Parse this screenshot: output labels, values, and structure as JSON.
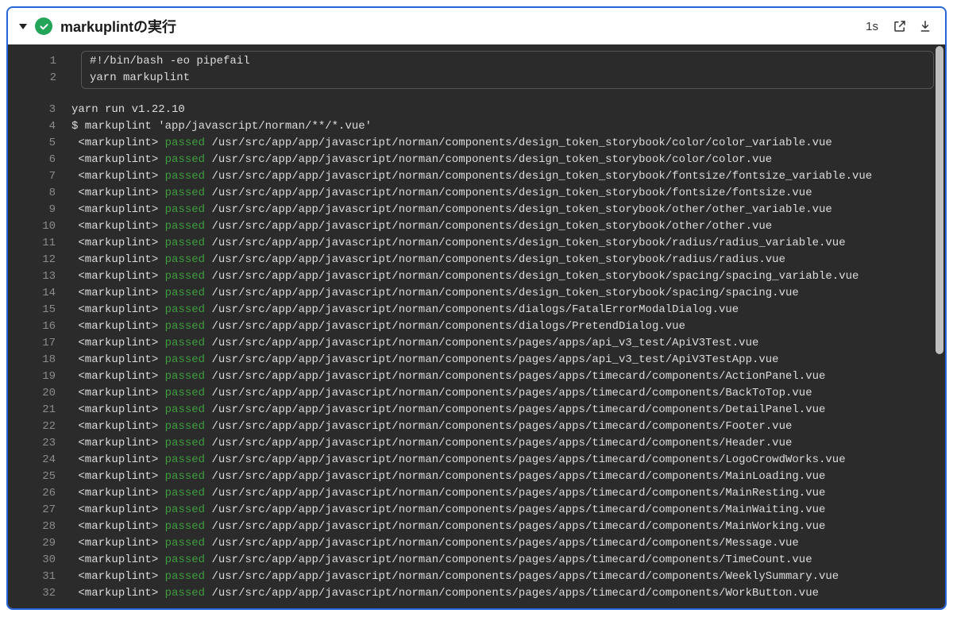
{
  "header": {
    "title": "markuplintの実行",
    "duration": "1s"
  },
  "commands": [
    {
      "ln": 1,
      "text": "#!/bin/bash -eo pipefail"
    },
    {
      "ln": 2,
      "text": "yarn markuplint"
    }
  ],
  "preamble": [
    {
      "ln": 3,
      "text": "yarn run v1.22.10"
    },
    {
      "ln": 4,
      "text": "$ markuplint 'app/javascript/norman/**/*.vue'"
    }
  ],
  "lines": [
    {
      "ln": 5,
      "path": "/usr/src/app/app/javascript/norman/components/design_token_storybook/color/color_variable.vue"
    },
    {
      "ln": 6,
      "path": "/usr/src/app/app/javascript/norman/components/design_token_storybook/color/color.vue"
    },
    {
      "ln": 7,
      "path": "/usr/src/app/app/javascript/norman/components/design_token_storybook/fontsize/fontsize_variable.vue"
    },
    {
      "ln": 8,
      "path": "/usr/src/app/app/javascript/norman/components/design_token_storybook/fontsize/fontsize.vue"
    },
    {
      "ln": 9,
      "path": "/usr/src/app/app/javascript/norman/components/design_token_storybook/other/other_variable.vue"
    },
    {
      "ln": 10,
      "path": "/usr/src/app/app/javascript/norman/components/design_token_storybook/other/other.vue"
    },
    {
      "ln": 11,
      "path": "/usr/src/app/app/javascript/norman/components/design_token_storybook/radius/radius_variable.vue"
    },
    {
      "ln": 12,
      "path": "/usr/src/app/app/javascript/norman/components/design_token_storybook/radius/radius.vue"
    },
    {
      "ln": 13,
      "path": "/usr/src/app/app/javascript/norman/components/design_token_storybook/spacing/spacing_variable.vue"
    },
    {
      "ln": 14,
      "path": "/usr/src/app/app/javascript/norman/components/design_token_storybook/spacing/spacing.vue"
    },
    {
      "ln": 15,
      "path": "/usr/src/app/app/javascript/norman/components/dialogs/FatalErrorModalDialog.vue"
    },
    {
      "ln": 16,
      "path": "/usr/src/app/app/javascript/norman/components/dialogs/PretendDialog.vue"
    },
    {
      "ln": 17,
      "path": "/usr/src/app/app/javascript/norman/components/pages/apps/api_v3_test/ApiV3Test.vue"
    },
    {
      "ln": 18,
      "path": "/usr/src/app/app/javascript/norman/components/pages/apps/api_v3_test/ApiV3TestApp.vue"
    },
    {
      "ln": 19,
      "path": "/usr/src/app/app/javascript/norman/components/pages/apps/timecard/components/ActionPanel.vue"
    },
    {
      "ln": 20,
      "path": "/usr/src/app/app/javascript/norman/components/pages/apps/timecard/components/BackToTop.vue"
    },
    {
      "ln": 21,
      "path": "/usr/src/app/app/javascript/norman/components/pages/apps/timecard/components/DetailPanel.vue"
    },
    {
      "ln": 22,
      "path": "/usr/src/app/app/javascript/norman/components/pages/apps/timecard/components/Footer.vue"
    },
    {
      "ln": 23,
      "path": "/usr/src/app/app/javascript/norman/components/pages/apps/timecard/components/Header.vue"
    },
    {
      "ln": 24,
      "path": "/usr/src/app/app/javascript/norman/components/pages/apps/timecard/components/LogoCrowdWorks.vue"
    },
    {
      "ln": 25,
      "path": "/usr/src/app/app/javascript/norman/components/pages/apps/timecard/components/MainLoading.vue"
    },
    {
      "ln": 26,
      "path": "/usr/src/app/app/javascript/norman/components/pages/apps/timecard/components/MainResting.vue"
    },
    {
      "ln": 27,
      "path": "/usr/src/app/app/javascript/norman/components/pages/apps/timecard/components/MainWaiting.vue"
    },
    {
      "ln": 28,
      "path": "/usr/src/app/app/javascript/norman/components/pages/apps/timecard/components/MainWorking.vue"
    },
    {
      "ln": 29,
      "path": "/usr/src/app/app/javascript/norman/components/pages/apps/timecard/components/Message.vue"
    },
    {
      "ln": 30,
      "path": "/usr/src/app/app/javascript/norman/components/pages/apps/timecard/components/TimeCount.vue"
    },
    {
      "ln": 31,
      "path": "/usr/src/app/app/javascript/norman/components/pages/apps/timecard/components/WeeklySummary.vue"
    },
    {
      "ln": 32,
      "path": "/usr/src/app/app/javascript/norman/components/pages/apps/timecard/components/WorkButton.vue"
    }
  ],
  "tokens": {
    "tag": "<markuplint>",
    "status": "passed"
  }
}
